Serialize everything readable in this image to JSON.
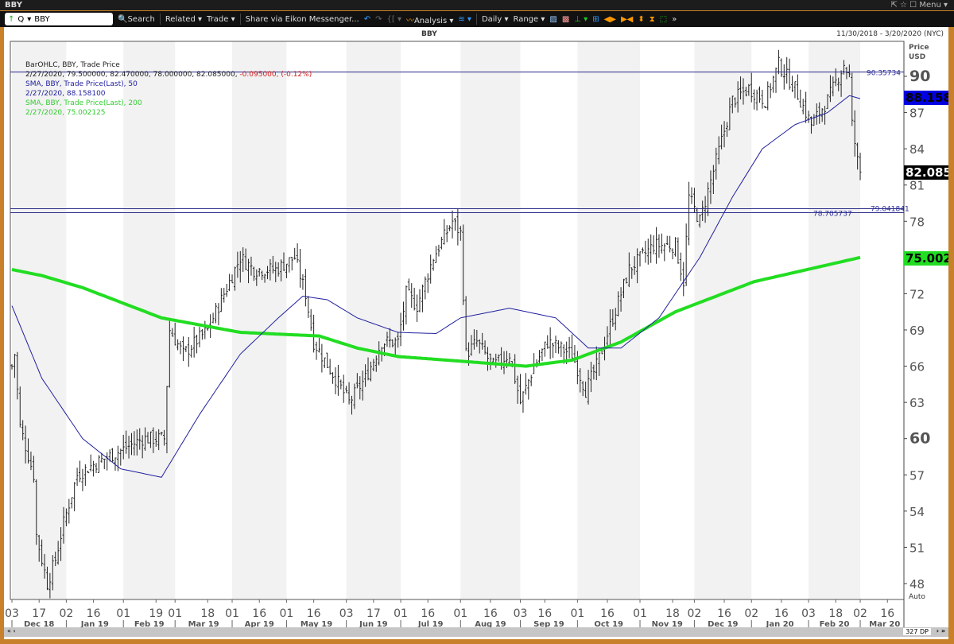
{
  "window": {
    "title": "BBY",
    "controls": "Menu"
  },
  "toolbar": {
    "symbol": "BBY",
    "search": "Search",
    "related": "Related",
    "trade": "Trade",
    "share": "Share via Eikon Messenger...",
    "analysis": "Analysis",
    "interval": "Daily",
    "range": "Range"
  },
  "chart_header": {
    "symbol": "BBY",
    "date_range": "11/30/2018 - 3/20/2020 (NYC)"
  },
  "legend": {
    "l1": "BarOHLC, BBY, Trade Price",
    "l2a": "2/27/2020, 79.500000, 82.470000, 78.000000, 82.085000, ",
    "l2b": "-0.095000, (-0.12%)",
    "l3": "SMA, BBY, Trade Price(Last),  50",
    "l4": "2/27/2020, 88.158100",
    "l5": "SMA, BBY, Trade Price(Last),  200",
    "l6": "2/27/2020, 75.002125"
  },
  "axis": {
    "price_label": "Price",
    "currency": "USD",
    "auto": "Auto"
  },
  "tags": {
    "sma50": "88.1581",
    "last": "82.085",
    "sma200": "75.0021"
  },
  "hlines": {
    "top": "90.35734",
    "mid1": "79.041841",
    "mid2": "78.705737"
  },
  "colors": {
    "sma50": "#2020a0",
    "sma200": "#22dd22",
    "hline": "#2a2a8a"
  },
  "scrollbar": {
    "dp": "327 DP"
  },
  "chart_data": {
    "type": "ohlc",
    "title": "BBY",
    "ylim": [
      46.5,
      95
    ],
    "yticks": [
      48,
      51,
      54,
      57,
      60,
      63,
      66,
      69,
      72,
      75,
      78,
      81,
      84,
      87,
      90
    ],
    "xtick_days": [
      "03",
      "17",
      "02",
      "16",
      "01",
      "19",
      "01",
      "18",
      "01",
      "16",
      "01",
      "16",
      "03",
      "17",
      "01",
      "16",
      "01",
      "16",
      "03",
      "16",
      "01",
      "16",
      "01",
      "18",
      "02",
      "16",
      "02",
      "16",
      "03",
      "18",
      "02",
      "16"
    ],
    "months": [
      "Dec 18",
      "Jan 19",
      "Feb 19",
      "Mar 19",
      "Apr 19",
      "May 19",
      "Jun 19",
      "Jul 19",
      "Aug 19",
      "Sep 19",
      "Oct 19",
      "Nov 19",
      "Dec 19",
      "Jan 20",
      "Feb 20",
      "Mar 20"
    ],
    "total_bars": 327,
    "close_waypoints": [
      [
        0,
        66
      ],
      [
        1,
        67
      ],
      [
        3,
        61
      ],
      [
        8,
        57
      ],
      [
        9,
        52
      ],
      [
        13,
        48
      ],
      [
        16,
        50
      ],
      [
        19,
        53
      ],
      [
        24,
        57
      ],
      [
        31,
        58
      ],
      [
        40,
        59
      ],
      [
        48,
        60
      ],
      [
        56,
        60
      ],
      [
        58,
        69
      ],
      [
        63,
        67
      ],
      [
        72,
        69
      ],
      [
        78,
        72
      ],
      [
        84,
        75
      ],
      [
        89,
        74
      ],
      [
        97,
        74
      ],
      [
        104,
        75
      ],
      [
        108,
        72
      ],
      [
        111,
        68
      ],
      [
        119,
        65
      ],
      [
        124,
        63
      ],
      [
        130,
        65
      ],
      [
        136,
        68
      ],
      [
        142,
        68
      ],
      [
        145,
        72
      ],
      [
        149,
        71
      ],
      [
        155,
        75
      ],
      [
        162,
        78
      ],
      [
        165,
        77
      ],
      [
        167,
        67
      ],
      [
        171,
        68
      ],
      [
        177,
        66
      ],
      [
        183,
        67
      ],
      [
        187,
        63
      ],
      [
        192,
        66
      ],
      [
        197,
        68
      ],
      [
        206,
        67
      ],
      [
        211,
        64
      ],
      [
        215,
        66
      ],
      [
        221,
        70
      ],
      [
        227,
        74
      ],
      [
        236,
        76
      ],
      [
        244,
        76
      ],
      [
        247,
        73
      ],
      [
        249,
        80
      ],
      [
        253,
        78
      ],
      [
        259,
        83
      ],
      [
        265,
        88
      ],
      [
        271,
        89
      ],
      [
        277,
        88
      ],
      [
        282,
        91
      ],
      [
        288,
        89
      ],
      [
        294,
        86
      ],
      [
        300,
        88
      ],
      [
        306,
        91
      ],
      [
        308,
        90
      ],
      [
        309,
        86
      ],
      [
        311,
        83
      ],
      [
        312,
        82.085
      ]
    ],
    "sma50_waypoints": [
      [
        0,
        71
      ],
      [
        11,
        65
      ],
      [
        26,
        60
      ],
      [
        40,
        57.5
      ],
      [
        55,
        56.8
      ],
      [
        69,
        62
      ],
      [
        84,
        67
      ],
      [
        98,
        70
      ],
      [
        107,
        71.8
      ],
      [
        116,
        71.5
      ],
      [
        127,
        70
      ],
      [
        142,
        68.8
      ],
      [
        156,
        68.7
      ],
      [
        165,
        70
      ],
      [
        183,
        70.8
      ],
      [
        200,
        70
      ],
      [
        212,
        67.5
      ],
      [
        224,
        67.5
      ],
      [
        238,
        70
      ],
      [
        253,
        75
      ],
      [
        265,
        80
      ],
      [
        276,
        84
      ],
      [
        288,
        86
      ],
      [
        300,
        87
      ],
      [
        308,
        88.4
      ],
      [
        312,
        88.158
      ]
    ],
    "sma200_waypoints": [
      [
        0,
        74
      ],
      [
        11,
        73.5
      ],
      [
        26,
        72.5
      ],
      [
        55,
        70
      ],
      [
        84,
        68.8
      ],
      [
        113,
        68.5
      ],
      [
        127,
        67.5
      ],
      [
        142,
        66.8
      ],
      [
        160,
        66.5
      ],
      [
        189,
        66
      ],
      [
        206,
        66.5
      ],
      [
        224,
        68
      ],
      [
        244,
        70.5
      ],
      [
        273,
        73
      ],
      [
        312,
        75.002
      ]
    ]
  }
}
